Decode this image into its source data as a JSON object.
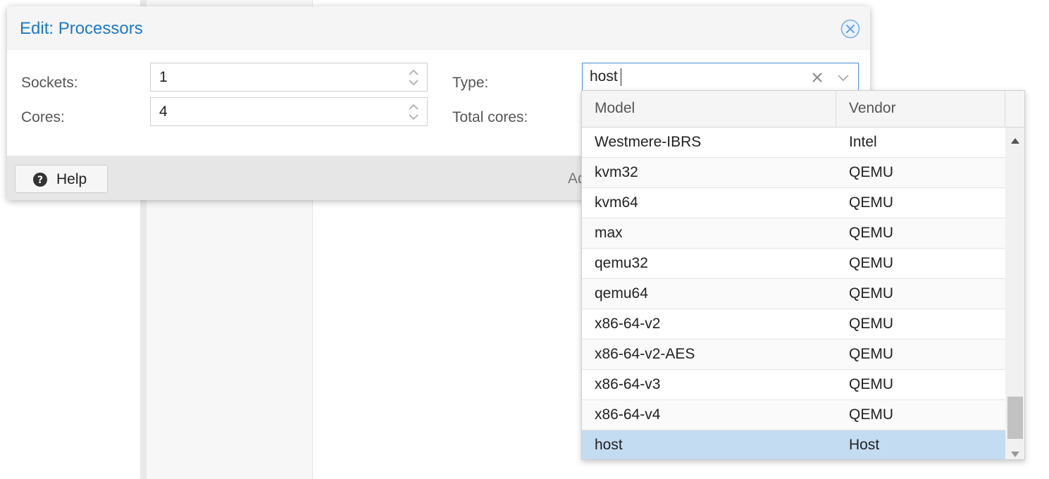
{
  "dialog": {
    "title": "Edit: Processors",
    "close_icon": "close-circle-icon",
    "fields": {
      "sockets_label": "Sockets:",
      "sockets_value": "1",
      "cores_label": "Cores:",
      "cores_value": "4",
      "type_label": "Type:",
      "type_value": "host",
      "total_cores_label": "Total cores:"
    },
    "footer": {
      "help_label": "Help",
      "help_icon": "question-circle-icon",
      "partial_text": "Ad"
    }
  },
  "dropdown": {
    "columns": [
      "Model",
      "Vendor"
    ],
    "rows": [
      {
        "model": "Westmere-IBRS",
        "vendor": "Intel"
      },
      {
        "model": "kvm32",
        "vendor": "QEMU"
      },
      {
        "model": "kvm64",
        "vendor": "QEMU"
      },
      {
        "model": "max",
        "vendor": "QEMU"
      },
      {
        "model": "qemu32",
        "vendor": "QEMU"
      },
      {
        "model": "qemu64",
        "vendor": "QEMU"
      },
      {
        "model": "x86-64-v2",
        "vendor": "QEMU"
      },
      {
        "model": "x86-64-v2-AES",
        "vendor": "QEMU"
      },
      {
        "model": "x86-64-v3",
        "vendor": "QEMU"
      },
      {
        "model": "x86-64-v4",
        "vendor": "QEMU"
      },
      {
        "model": "host",
        "vendor": "Host"
      }
    ],
    "selected_model": "host"
  },
  "colors": {
    "title_blue": "#1c79c4",
    "selected_row": "#c4dcf2",
    "focus_border": "#4a90d9"
  }
}
